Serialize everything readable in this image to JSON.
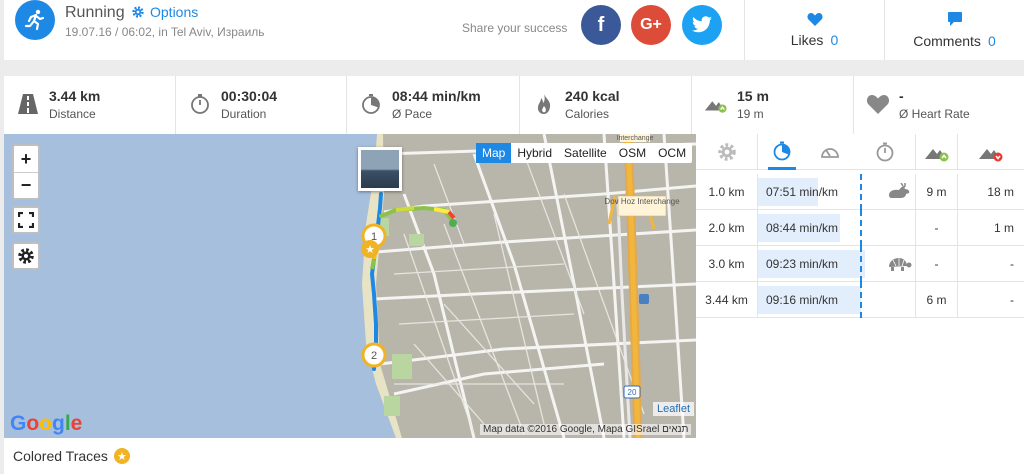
{
  "activity": {
    "title": "Running",
    "options_label": "Options",
    "subtitle": "19.07.16 / 06:02, in Tel Aviv, Израиль",
    "share_label": "Share your success",
    "social": {
      "facebook": "f",
      "google_plus": "G+",
      "twitter": "t"
    }
  },
  "likes": {
    "label": "Likes",
    "count": "0"
  },
  "comments": {
    "label": "Comments",
    "count": "0"
  },
  "stats": [
    {
      "value": "3.44 km",
      "label": "Distance",
      "icon": "road-icon"
    },
    {
      "value": "00:30:04",
      "label": "Duration",
      "icon": "stopwatch-icon"
    },
    {
      "value": "08:44 min/km",
      "label": "Ø Pace",
      "icon": "pace-icon"
    },
    {
      "value": "240 kcal",
      "label": "Calories",
      "icon": "flame-icon"
    },
    {
      "value": "15 m",
      "label": "19 m",
      "icon": "elevation-icon"
    },
    {
      "value": "-",
      "label": "Ø Heart Rate",
      "icon": "heart-icon"
    }
  ],
  "map": {
    "zoom_in": "+",
    "zoom_out": "−",
    "layers": [
      "Map",
      "Hybrid",
      "Satellite",
      "OSM",
      "OCM"
    ],
    "active_layer": "Map",
    "markers": [
      "1",
      "2"
    ],
    "leaflet_label": "Leaflet",
    "attribution": "Map data ©2016 Google, Mapa GISrael",
    "attribution_rtl": "תנאים",
    "road_label_20": "20",
    "interchange_1": "Interchange",
    "interchange_2": "Dov Hoz Interchange",
    "google_logo": "Google"
  },
  "colored_traces": {
    "label": "Colored Traces"
  },
  "splits": {
    "rows": [
      {
        "distance": "1.0 km",
        "pace": "07:51 min/km",
        "pace_fraction": 0.38,
        "animal": "rabbit-icon",
        "up": "9 m",
        "down": "18 m"
      },
      {
        "distance": "2.0 km",
        "pace": "08:44 min/km",
        "pace_fraction": 0.52,
        "animal": "",
        "up": "-",
        "down": "1 m"
      },
      {
        "distance": "3.0 km",
        "pace": "09:23 min/km",
        "pace_fraction": 0.68,
        "animal": "turtle-icon",
        "up": "-",
        "down": "-"
      },
      {
        "distance": "3.44 km",
        "pace": "09:16 min/km",
        "pace_fraction": 0.65,
        "animal": "",
        "up": "6 m",
        "down": "-"
      }
    ]
  },
  "colors": {
    "accent": "#1e88e5",
    "facebook": "#3b5998",
    "google": "#dd4b39",
    "twitter": "#1da1f2",
    "star": "#f0b323"
  }
}
